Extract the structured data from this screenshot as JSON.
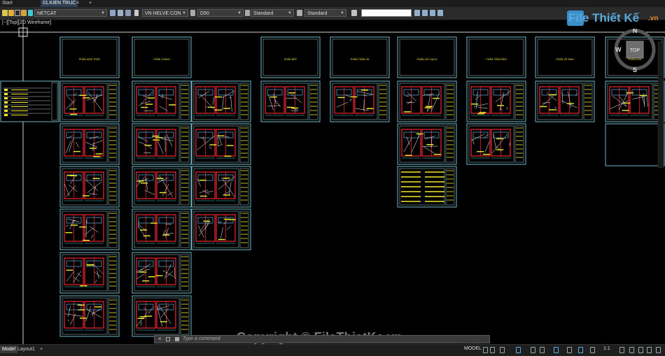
{
  "tabs": [
    {
      "label": "Start"
    },
    {
      "label": "01.KIEN TRUC"
    },
    {
      "label": "+"
    }
  ],
  "toolbar": {
    "layer_value": "NETCAT",
    "textstyle_value": "VN HELVE CON",
    "dimscale_value": "D50",
    "tablestyle_value": "Standard",
    "mleaderstyle_value": "Standard"
  },
  "viewport": {
    "label": "[−][Top][2D Wireframe]"
  },
  "viewcube": {
    "n": "N",
    "s": "S",
    "w": "W",
    "face": "TOP"
  },
  "watermark": {
    "logo_text": "File Thiết Kế",
    "logo_suffix": ".vn",
    "copyright": "Copyright © FileThietKe.vn"
  },
  "command": {
    "placeholder": "Type a command",
    "close": "×"
  },
  "status": {
    "layout_tabs": [
      {
        "label": "Model"
      },
      {
        "label": "Layout1"
      },
      {
        "label": "+"
      }
    ],
    "model_label": "MODEL",
    "scale_label": "1:1"
  },
  "covers": [
    {
      "title": "PHẦN KIẾN TRÚC"
    },
    {
      "title": "PHẦN THANG"
    },
    {
      "title": "PHẦN BẾP"
    },
    {
      "title": "PHẦN TRẦN VS"
    },
    {
      "title": "PHẦN LÁT GẠCH"
    },
    {
      "title": "PHẦN TRẦN ĐÈN"
    },
    {
      "title": "PHẦN VỆ SINH"
    },
    {
      "title": "PHẦN CỬA"
    }
  ],
  "colors": {
    "sheet_border": "#6fb9c9",
    "drawing_red": "#e2242a",
    "annotation_yellow": "#f3ea2a",
    "accent_blue": "#2e3f52"
  }
}
